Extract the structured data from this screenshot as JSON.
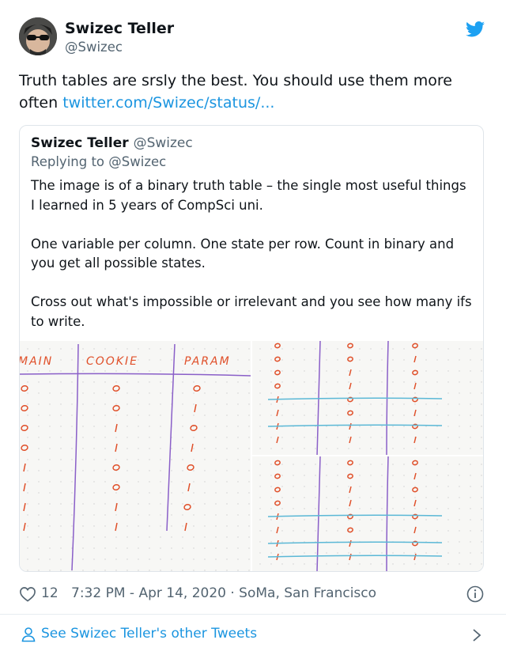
{
  "tweet": {
    "author": {
      "name": "Swizec Teller",
      "handle": "@Swizec"
    },
    "text": "Truth tables are srsly the best. You should use them more often ",
    "link": "twitter.com/Swizec/status/...",
    "quoted": {
      "name": "Swizec Teller",
      "handle": "@Swizec",
      "replying": "Replying to @Swizec",
      "paragraphs": [
        "The image is of a binary truth table – the single most useful things I learned in 5 years of CompSci uni.",
        "One variable per column. One state per row. Count in binary and you get all possible states.",
        "Cross out what's impossible or irrelevant and you see how many ifs to write."
      ],
      "image_headers": [
        "MAIN",
        "COOKIE",
        "PARAM"
      ]
    },
    "likes": "12",
    "timestamp": "7:32 PM - Apr 14, 2020 · SoMa, San Francisco",
    "footer_label": "See Swizec Teller's other Tweets"
  },
  "colors": {
    "link": "#1b95e0",
    "secondary": "#536471",
    "ink": "#e0502a",
    "column_line": "#8a5fc8",
    "strike_line": "#5bb8d6"
  }
}
